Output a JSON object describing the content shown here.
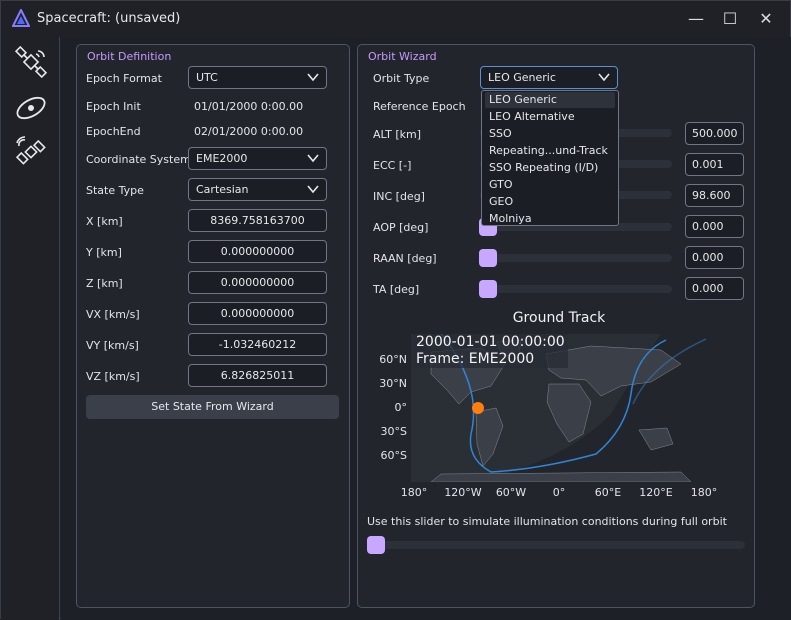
{
  "window": {
    "title": "Spacecraft: (unsaved)",
    "controls": {
      "minimize": "—",
      "maximize": "☐",
      "close": "✕"
    }
  },
  "sidebar": {
    "icons": [
      "satellite-icon",
      "orbit-icon",
      "satellite-dish-icon"
    ]
  },
  "orbit_definition": {
    "title": "Orbit Definition",
    "epoch_format": {
      "label": "Epoch Format",
      "value": "UTC"
    },
    "epoch_init": {
      "label": "Epoch Init",
      "value": "01/01/2000 0:00.00"
    },
    "epoch_end": {
      "label": "EpochEnd",
      "value": "02/01/2000 0:00.00"
    },
    "coordinate_system": {
      "label": "Coordinate System",
      "value": "EME2000"
    },
    "state_type": {
      "label": "State Type",
      "value": "Cartesian"
    },
    "state": [
      {
        "label": "X [km]",
        "value": "8369.758163700"
      },
      {
        "label": "Y [km]",
        "value": "0.000000000"
      },
      {
        "label": "Z [km]",
        "value": "0.000000000"
      },
      {
        "label": "VX [km/s]",
        "value": "0.000000000"
      },
      {
        "label": "VY [km/s]",
        "value": "-1.032460212"
      },
      {
        "label": "VZ [km/s]",
        "value": "6.826825011"
      }
    ],
    "set_state_button": "Set State From Wizard"
  },
  "orbit_wizard": {
    "title": "Orbit Wizard",
    "orbit_type": {
      "label": "Orbit Type",
      "value": "LEO Generic"
    },
    "reference_epoch": {
      "label": "Reference Epoch"
    },
    "params": [
      {
        "label": "ALT [km]",
        "value": "500.000"
      },
      {
        "label": "ECC [-]",
        "value": "0.001"
      },
      {
        "label": "INC [deg]",
        "value": "98.600"
      },
      {
        "label": "AOP [deg]",
        "value": "0.000"
      },
      {
        "label": "RAAN [deg]",
        "value": "0.000"
      },
      {
        "label": "TA [deg]",
        "value": "0.000"
      }
    ],
    "dropdown_options": [
      "LEO Generic",
      "LEO Alternative",
      "SSO",
      "Repeating...und-Track",
      "SSO Repeating (I/D)",
      "GTO",
      "GEO",
      "Molniya"
    ],
    "dropdown_selected": 0,
    "ground_track": {
      "title": "Ground Track",
      "overlay_time": "2000-01-01 00:00:00",
      "overlay_frame": "Frame: EME2000",
      "lat_labels": [
        "60°N",
        "30°N",
        "0°",
        "30°S",
        "60°S"
      ],
      "lon_labels": [
        "180°",
        "120°W",
        "60°W",
        "0°",
        "60°E",
        "120°E",
        "180°"
      ],
      "track_color": "#2f86d6",
      "marker_color": "#ff7f0e"
    },
    "illumination_hint": "Use this slider to simulate illumination conditions during full orbit",
    "accent": "#c7a7ff"
  }
}
